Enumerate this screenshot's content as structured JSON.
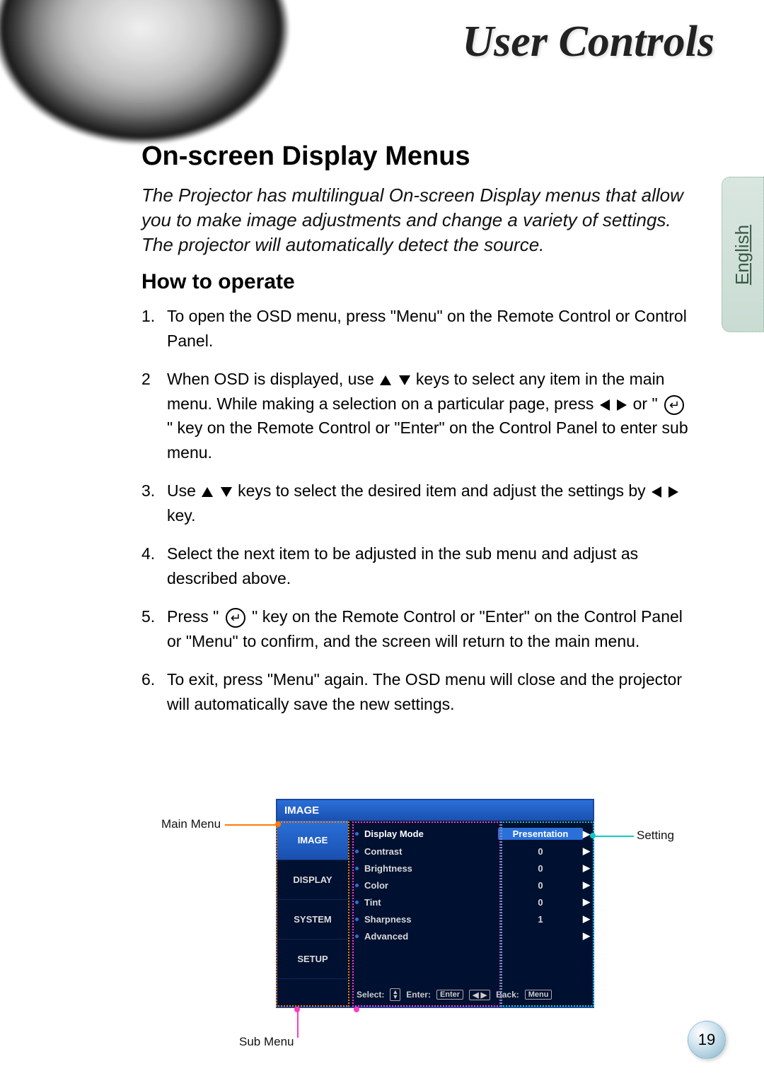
{
  "header": {
    "title": "User Controls"
  },
  "lang_tab": "English",
  "section": {
    "h1": "On-screen Display Menus",
    "intro": "The Projector has multilingual On-screen Display menus that allow you to make image adjustments and change a variety of settings. The projector will automatically detect the source.",
    "h2": "How to operate"
  },
  "steps": {
    "s1": "To open the OSD menu, press \"Menu\" on the Remote Control or Control Panel.",
    "s2a": "When OSD is displayed, use ",
    "s2b": " keys to select any item in the main menu.  While making a selection on a particular page, press ",
    "s2c": " or \" ",
    "s2d": " \" key on the Remote Control or \"Enter\" on the Control Panel to enter sub menu.",
    "s3a": "Use ",
    "s3b": " keys to select the desired item and adjust the settings by ",
    "s3c": " key.",
    "s4": "Select the next item to be adjusted in the sub menu and adjust as described above.",
    "s5a": "Press \" ",
    "s5b": " \" key on the Remote Control or \"Enter\" on the Control Panel or \"Menu\" to confirm, and the screen will return to the main menu.",
    "s6": "To exit, press \"Menu\" again.  The OSD menu will close and the projector will automatically save the new settings."
  },
  "osd": {
    "title": "IMAGE",
    "tabs": [
      "IMAGE",
      "DISPLAY",
      "SYSTEM",
      "SETUP"
    ],
    "rows": [
      {
        "label": "Display Mode",
        "value": "Presentation",
        "selected": true
      },
      {
        "label": "Contrast",
        "value": "0"
      },
      {
        "label": "Brightness",
        "value": "0"
      },
      {
        "label": "Color",
        "value": "0"
      },
      {
        "label": "Tint",
        "value": "0"
      },
      {
        "label": "Sharpness",
        "value": "1"
      },
      {
        "label": "Advanced",
        "value": ""
      }
    ],
    "footer": {
      "select": "Select:",
      "enter": "Enter:",
      "enter_key": "Enter",
      "back": "Back:",
      "menu_key": "Menu"
    }
  },
  "callouts": {
    "main": "Main Menu",
    "sub": "Sub Menu",
    "setting": "Setting"
  },
  "page_number": "19"
}
